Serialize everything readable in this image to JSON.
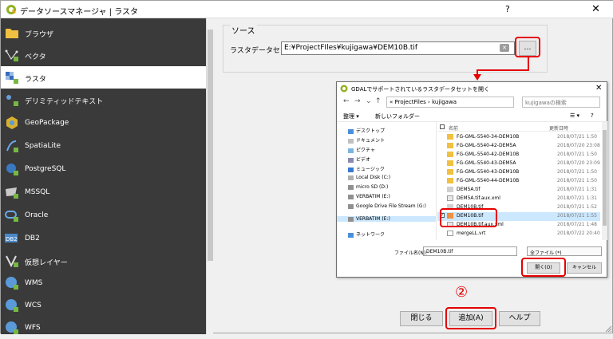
{
  "window": {
    "title": "データソースマネージャ | ラスタ",
    "help_label": "?",
    "close_label": "✕"
  },
  "sidebar": {
    "items": [
      {
        "label": "ブラウザ",
        "icon": "folder-icon",
        "active": false
      },
      {
        "label": "ベクタ",
        "icon": "vector-icon",
        "active": false
      },
      {
        "label": "ラスタ",
        "icon": "raster-icon",
        "active": true
      },
      {
        "label": "デリミティッドテキスト",
        "icon": "delimited-text-icon",
        "active": false
      },
      {
        "label": "GeoPackage",
        "icon": "geopackage-icon",
        "active": false
      },
      {
        "label": "SpatiaLite",
        "icon": "spatialite-icon",
        "active": false
      },
      {
        "label": "PostgreSQL",
        "icon": "postgresql-icon",
        "active": false
      },
      {
        "label": "MSSQL",
        "icon": "mssql-icon",
        "active": false
      },
      {
        "label": "Oracle",
        "icon": "oracle-icon",
        "active": false
      },
      {
        "label": "DB2",
        "icon": "db2-icon",
        "active": false
      },
      {
        "label": "仮想レイヤー",
        "icon": "virtual-layer-icon",
        "active": false
      },
      {
        "label": "WMS",
        "icon": "wms-icon",
        "active": false
      },
      {
        "label": "WCS",
        "icon": "wcs-icon",
        "active": false
      },
      {
        "label": "WFS",
        "icon": "wfs-icon",
        "active": false
      }
    ]
  },
  "source": {
    "group_title": "ソース",
    "raster_label": "ラスタデータセット",
    "path_value": "E:¥ProjectFIles¥kujigawa¥DEM10B.tif",
    "browse_label": "…"
  },
  "buttons": {
    "close": "閉じる",
    "add": "追加(A)",
    "help": "ヘルプ"
  },
  "annotation": {
    "step": "②"
  },
  "dialog": {
    "title": "GDALでサポートされているラスタデータセットを開く",
    "address": "« ProjectFiles › kujigawa",
    "search_placeholder": "kujigawaの検索",
    "organize": "整理 ▾",
    "new_folder": "新しいフォルダー",
    "nav_items": [
      "デスクトップ",
      "ドキュメント",
      "ピクチャ",
      "ビデオ",
      "ミュージック",
      "Local Disk (C:)",
      "micro SD (D:)",
      "VERBATIM (E:)",
      "Google Drive File Stream (G:)",
      "VERBATIM (E:)",
      "ネットワーク"
    ],
    "col_name": "名前",
    "col_date": "更新日時",
    "files": [
      {
        "name": "FG-GML-5540-34-DEM10B",
        "date": "2018/07/21 1:50",
        "type": "folder"
      },
      {
        "name": "FG-GML-5540-42-DEM5A",
        "date": "2018/07/20 23:08",
        "type": "folder"
      },
      {
        "name": "FG-GML-5540-42-DEM10B",
        "date": "2018/07/21 1:50",
        "type": "folder"
      },
      {
        "name": "FG-GML-5540-43-DEM5A",
        "date": "2018/07/20 23:09",
        "type": "folder"
      },
      {
        "name": "FG-GML-5540-43-DEM10B",
        "date": "2018/07/21 1:50",
        "type": "folder"
      },
      {
        "name": "FG-GML-5540-44-DEM10B",
        "date": "2018/07/21 1:50",
        "type": "folder"
      },
      {
        "name": "DEM5A.tif",
        "date": "2018/07/21 1:31",
        "type": "tif"
      },
      {
        "name": "DEM5A.tif.aux.xml",
        "date": "2018/07/21 1:31",
        "type": "xml"
      },
      {
        "name": "DEM10B.tif",
        "date": "2018/07/21 1:52",
        "type": "tif"
      },
      {
        "name": "DEM10B.tif",
        "date": "2018/07/21 1:55",
        "type": "tif"
      },
      {
        "name": "DEM10B.tif.aux.xml",
        "date": "2018/07/21 1:48",
        "type": "xml"
      },
      {
        "name": "mergeLL.vrt",
        "date": "2018/07/22 20:40",
        "type": "vrt"
      }
    ],
    "filename_label": "ファイル名(N):",
    "filename_value": "DEM10B.tif",
    "filetype_value": "全ファイル (*)",
    "open_label": "開く(O)",
    "cancel_label": "キャンセル"
  }
}
